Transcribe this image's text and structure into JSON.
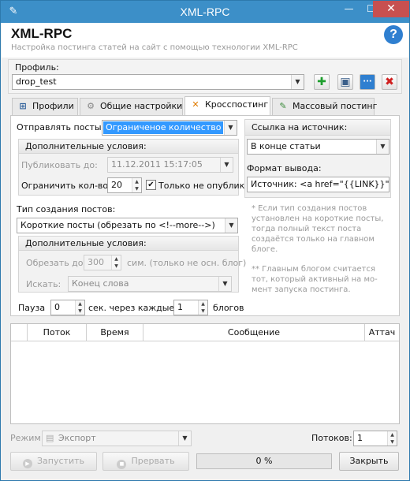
{
  "window": {
    "title": "XML-RPC",
    "min_glyph": "—",
    "max_glyph": "☐",
    "close_glyph": "✕"
  },
  "header": {
    "title": "XML-RPC",
    "subtitle": "Настройка постинга статей на сайт с помощью технологии XML-RPC",
    "help_glyph": "?"
  },
  "profile": {
    "label": "Профиль:",
    "value": "drop_test"
  },
  "toolbar": {
    "add_glyph": "✚",
    "save_glyph": "▣",
    "more_glyph": "···",
    "delete_glyph": "✖"
  },
  "tabs": [
    {
      "label": "Профили",
      "glyph": "⊞"
    },
    {
      "label": "Общие настройки",
      "glyph": "⚙"
    },
    {
      "label": "Кросспостинг",
      "glyph": "✕"
    },
    {
      "label": "Массовый постинг",
      "glyph": "✎"
    }
  ],
  "crosspost": {
    "send_label": "Отправлять посты:",
    "send_value": "Ограниченое количество",
    "extra1": {
      "title": "Дополнительные условия:",
      "publish_label": "Публиковать до:",
      "publish_value": "11.12.2011 15:17:05",
      "limit_label": "Ограничить кол-во:",
      "limit_value": "20",
      "unpublished_label": "Только не опублик",
      "unpublished_checked": true
    },
    "type_label": "Тип создания постов:",
    "type_value": "Короткие посты (обрезать по <!--more-->)",
    "extra2": {
      "title": "Дополнительные условия:",
      "trim_label": "Обрезать до:",
      "trim_value": "300",
      "trim_unit": "сим. (только не осн. блог)",
      "search_label": "Искать:",
      "search_value": "Конец слова"
    },
    "pause_label": "Пауза",
    "pause_value": "0",
    "every_label": "сек. через каждые",
    "every_value": "1",
    "blogs_label": "блогов",
    "source": {
      "title": "Ссылка на источник:",
      "position_value": "В конце статьи",
      "format_label": "Формат вывода:",
      "format_value": "Источник: <a href=\"{{LINK}}\">{{TI"
    },
    "note1": "* Если тип создания постов установлен на короткие посты, тогда полный текст поста создаётся только на главном блоге.",
    "note2": "** Главным блогом считается тот, который активный на мо-мент запуска постинга."
  },
  "grid": {
    "columns": [
      "",
      "Поток",
      "Время",
      "Сообщение",
      "Аттач"
    ]
  },
  "footer": {
    "mode_label": "Режим:",
    "mode_value": "Экспорт",
    "threads_label": "Потоков:",
    "threads_value": "1",
    "start_label": "Запустить",
    "stop_label": "Прервать",
    "progress_text": "0 %",
    "progress_fraction": 0,
    "close_label": "Закрыть"
  },
  "colors": {
    "accent": "#3c8fc8",
    "selected": "#3399ff",
    "close_red": "#c75050",
    "progress": "#06b025"
  }
}
